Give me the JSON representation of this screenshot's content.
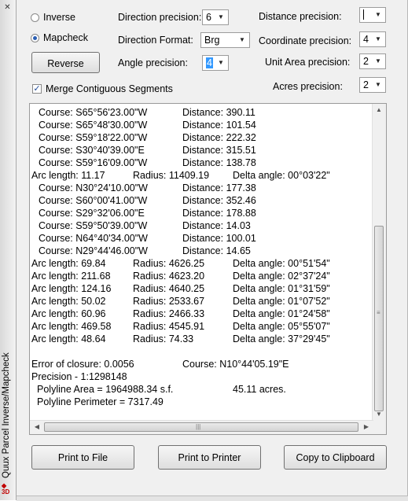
{
  "window": {
    "title": "Quux Parcel Inverse/Mapcheck"
  },
  "mode": {
    "inverse_label": "Inverse",
    "mapcheck_label": "Mapcheck",
    "selected": "Mapcheck"
  },
  "reverse_label": "Reverse",
  "merge": {
    "checked": true,
    "label": "Merge  Contiguous  Segments"
  },
  "settings": {
    "direction_precision": {
      "label": "Direction precision:",
      "value": "6"
    },
    "direction_format": {
      "label": "Direction Format:",
      "value": "Brg"
    },
    "angle_precision": {
      "label": "Angle precision:",
      "value": "4"
    },
    "distance_precision": {
      "label": "Distance precision:",
      "value": ""
    },
    "coordinate_precision": {
      "label": "Coordinate precision:",
      "value": "4"
    },
    "unit_area_precision": {
      "label": "Unit Area precision:",
      "value": "2"
    },
    "acres_precision": {
      "label": "Acres precision:",
      "value": "2"
    }
  },
  "output": {
    "lines": [
      {
        "type": "course",
        "course": "Course: S65°56'23.00\"W",
        "distance": "Distance: 390.11"
      },
      {
        "type": "course",
        "course": "Course: S65°48'30.00\"W",
        "distance": "Distance: 101.54"
      },
      {
        "type": "course",
        "course": "Course: S59°18'22.00\"W",
        "distance": "Distance: 222.32"
      },
      {
        "type": "course",
        "course": "Course: S30°40'39.00\"E",
        "distance": "Distance: 315.51"
      },
      {
        "type": "course",
        "course": "Course: S59°16'09.00\"W",
        "distance": "Distance: 138.78"
      },
      {
        "type": "arc1",
        "arc": "Arc length: 11.17",
        "radius": "Radius: 11409.19",
        "delta": "Delta angle: 00°03'22\""
      },
      {
        "type": "course",
        "course": "Course: N30°24'10.00\"W",
        "distance": "Distance: 177.38"
      },
      {
        "type": "course",
        "course": "Course: S60°00'41.00\"W",
        "distance": "Distance: 352.46"
      },
      {
        "type": "course",
        "course": "Course: S29°32'06.00\"E",
        "distance": "Distance: 178.88"
      },
      {
        "type": "course",
        "course": "Course: S59°50'39.00\"W",
        "distance": "Distance: 14.03"
      },
      {
        "type": "course",
        "course": "Course: N64°40'34.00\"W",
        "distance": "Distance: 100.01"
      },
      {
        "type": "course",
        "course": "Course: N29°44'46.00\"W",
        "distance": "Distance: 14.65"
      },
      {
        "type": "arc",
        "arc": "Arc length: 69.84",
        "radius": "Radius: 4626.25",
        "delta": "Delta angle: 00°51'54\""
      },
      {
        "type": "arc",
        "arc": "Arc length: 211.68",
        "radius": "Radius: 4623.20",
        "delta": "Delta angle: 02°37'24\""
      },
      {
        "type": "arc",
        "arc": "Arc length: 124.16",
        "radius": "Radius: 4640.25",
        "delta": "Delta angle: 01°31'59\""
      },
      {
        "type": "arc",
        "arc": "Arc length: 50.02",
        "radius": "Radius: 2533.67",
        "delta": "Delta angle: 01°07'52\""
      },
      {
        "type": "arc",
        "arc": "Arc length: 60.96",
        "radius": "Radius: 2466.33",
        "delta": "Delta angle: 01°24'58\""
      },
      {
        "type": "arc",
        "arc": "Arc length: 469.58",
        "radius": "Radius: 4545.91",
        "delta": "Delta angle: 05°55'07\""
      },
      {
        "type": "arc",
        "arc": "Arc length: 48.64",
        "radius": "Radius: 74.33",
        "delta": "Delta angle: 37°29'45\""
      }
    ],
    "closure": {
      "error": "Error of closure: 0.0056",
      "course": "Course: N10°44'05.19\"E"
    },
    "precision": "Precision - 1:1298148",
    "area": {
      "sf": "Polyline Area = 1964988.34 s.f.",
      "acres": "45.11 acres."
    },
    "perimeter": "Polyline Perimeter = 7317.49"
  },
  "buttons": {
    "print_file": "Print to File",
    "print_printer": "Print to Printer",
    "copy_clipboard": "Copy to Clipboard"
  },
  "colors": {
    "accent": "#3399ff",
    "panel": "#f0f0f0"
  }
}
